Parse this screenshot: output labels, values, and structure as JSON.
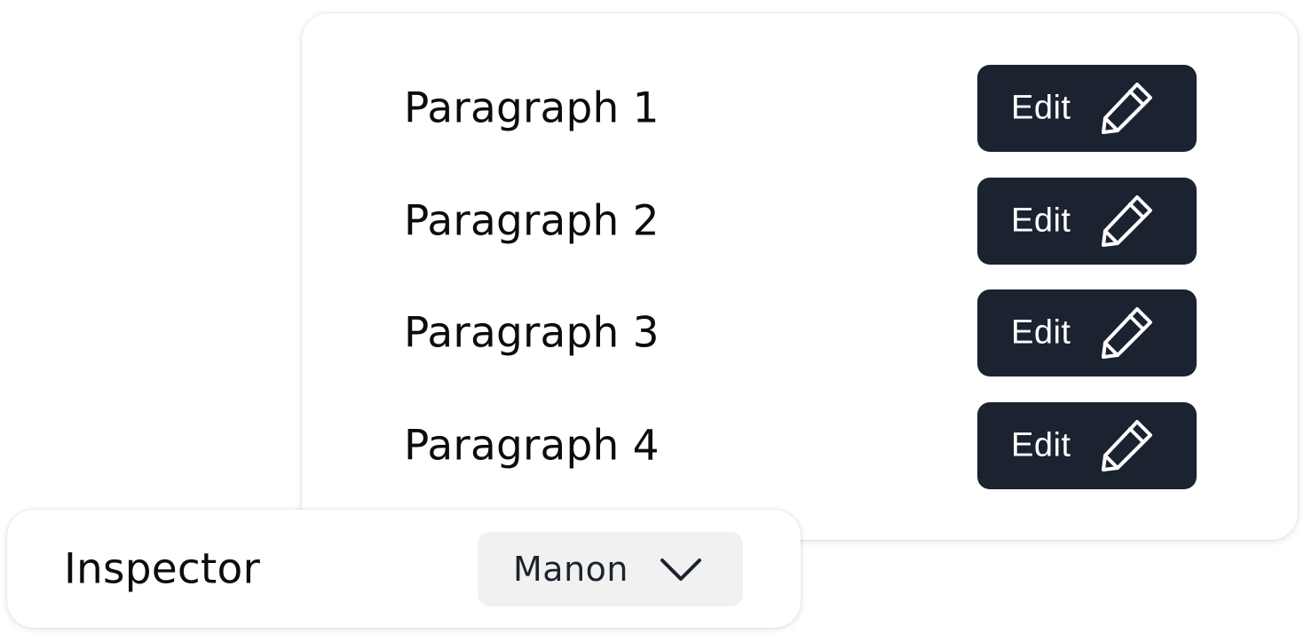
{
  "paragraphs": [
    {
      "label": "Paragraph 1",
      "button_label": "Edit",
      "button_icon": "pencil-icon"
    },
    {
      "label": "Paragraph 2",
      "button_label": "Edit",
      "button_icon": "pencil-icon"
    },
    {
      "label": "Paragraph 3",
      "button_label": "Edit",
      "button_icon": "pencil-icon"
    },
    {
      "label": "Paragraph 4",
      "button_label": "Edit",
      "button_icon": "pencil-icon"
    }
  ],
  "inspector": {
    "label": "Inspector",
    "selected": "Manon",
    "icon": "chevron-down-icon"
  },
  "colors": {
    "button_bg": "#1b2330",
    "button_text": "#ffffff",
    "dropdown_bg": "#f1f1f2",
    "text": "#0c0c0e"
  }
}
